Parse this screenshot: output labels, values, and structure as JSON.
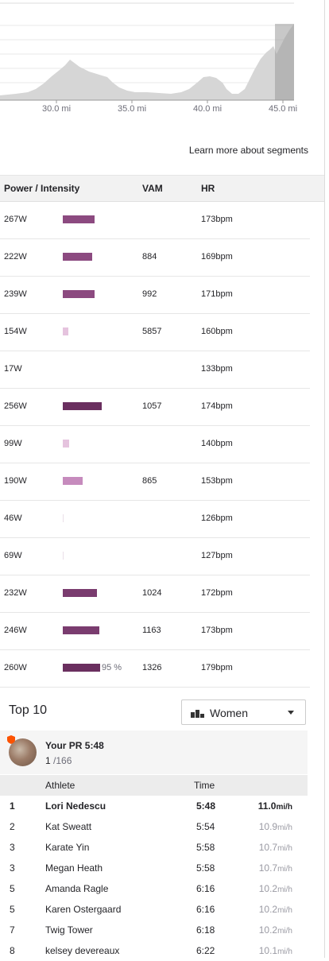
{
  "elevation": {
    "ticks": [
      "30.0 mi",
      "35.0 mi",
      "40.0 mi",
      "45.0 mi"
    ]
  },
  "learn_more": "Learn more about segments",
  "table": {
    "headers": {
      "power": "Power / Intensity",
      "vam": "VAM",
      "hr": "HR"
    },
    "rows": [
      {
        "power": "267W",
        "intensity": 0.82,
        "color": "#8c4a80",
        "vam": "",
        "hr": "173",
        "hr_unit": "bpm"
      },
      {
        "power": "222W",
        "intensity": 0.76,
        "color": "#8c4a80",
        "vam": "884",
        "hr": "169",
        "hr_unit": "bpm"
      },
      {
        "power": "239W",
        "intensity": 0.82,
        "color": "#8c4a80",
        "vam": "992",
        "hr": "171",
        "hr_unit": "bpm"
      },
      {
        "power": "154W",
        "intensity": 0.15,
        "color": "#e5c3de",
        "vam": "5857",
        "hr": "160",
        "hr_unit": "bpm"
      },
      {
        "power": "17W",
        "intensity": 0,
        "color": "#ffffff",
        "vam": "",
        "hr": "133",
        "hr_unit": "bpm"
      },
      {
        "power": "256W",
        "intensity": 1.0,
        "color": "#6a2f5f",
        "vam": "1057",
        "hr": "174",
        "hr_unit": "bpm"
      },
      {
        "power": "99W",
        "intensity": 0.17,
        "color": "#e5c3de",
        "vam": "",
        "hr": "140",
        "hr_unit": "bpm"
      },
      {
        "power": "190W",
        "intensity": 0.5,
        "color": "#c68bbd",
        "vam": "865",
        "hr": "153",
        "hr_unit": "bpm"
      },
      {
        "power": "46W",
        "intensity": 0.02,
        "color": "#eadfe8",
        "vam": "",
        "hr": "126",
        "hr_unit": "bpm"
      },
      {
        "power": "69W",
        "intensity": 0.02,
        "color": "#eadfe8",
        "vam": "",
        "hr": "127",
        "hr_unit": "bpm"
      },
      {
        "power": "232W",
        "intensity": 0.87,
        "color": "#7a3c6f",
        "vam": "1024",
        "hr": "172",
        "hr_unit": "bpm"
      },
      {
        "power": "246W",
        "intensity": 0.93,
        "color": "#7a3c6f",
        "vam": "1163",
        "hr": "173",
        "hr_unit": "bpm"
      },
      {
        "power": "260W",
        "intensity": 0.95,
        "color": "#6a2f5f",
        "pct": "95 %",
        "vam": "1326",
        "hr": "179",
        "hr_unit": "bpm"
      }
    ]
  },
  "top10": {
    "title": "Top 10",
    "filter": "Women",
    "pr_label": "Your PR 5:48",
    "pr_rank": "1",
    "pr_total": " /166",
    "headers": {
      "athlete": "Athlete",
      "time": "Time"
    },
    "rows": [
      {
        "rank": "1",
        "name": "Lori Nedescu",
        "time": "5:48",
        "speed": "11.0",
        "unit": "mi/h",
        "highlight": true
      },
      {
        "rank": "2",
        "name": "Kat Sweatt",
        "time": "5:54",
        "speed": "10.9",
        "unit": "mi/h"
      },
      {
        "rank": "3",
        "name": "Karate Yin",
        "time": "5:58",
        "speed": "10.7",
        "unit": "mi/h"
      },
      {
        "rank": "3",
        "name": "Megan Heath",
        "time": "5:58",
        "speed": "10.7",
        "unit": "mi/h"
      },
      {
        "rank": "5",
        "name": "Amanda Ragle",
        "time": "6:16",
        "speed": "10.2",
        "unit": "mi/h"
      },
      {
        "rank": "5",
        "name": "Karen Ostergaard",
        "time": "6:16",
        "speed": "10.2",
        "unit": "mi/h"
      },
      {
        "rank": "7",
        "name": "Twig Tower",
        "time": "6:18",
        "speed": "10.2",
        "unit": "mi/h"
      },
      {
        "rank": "8",
        "name": "kelsey devereaux",
        "time": "6:22",
        "speed": "10.1",
        "unit": "mi/h"
      }
    ]
  }
}
